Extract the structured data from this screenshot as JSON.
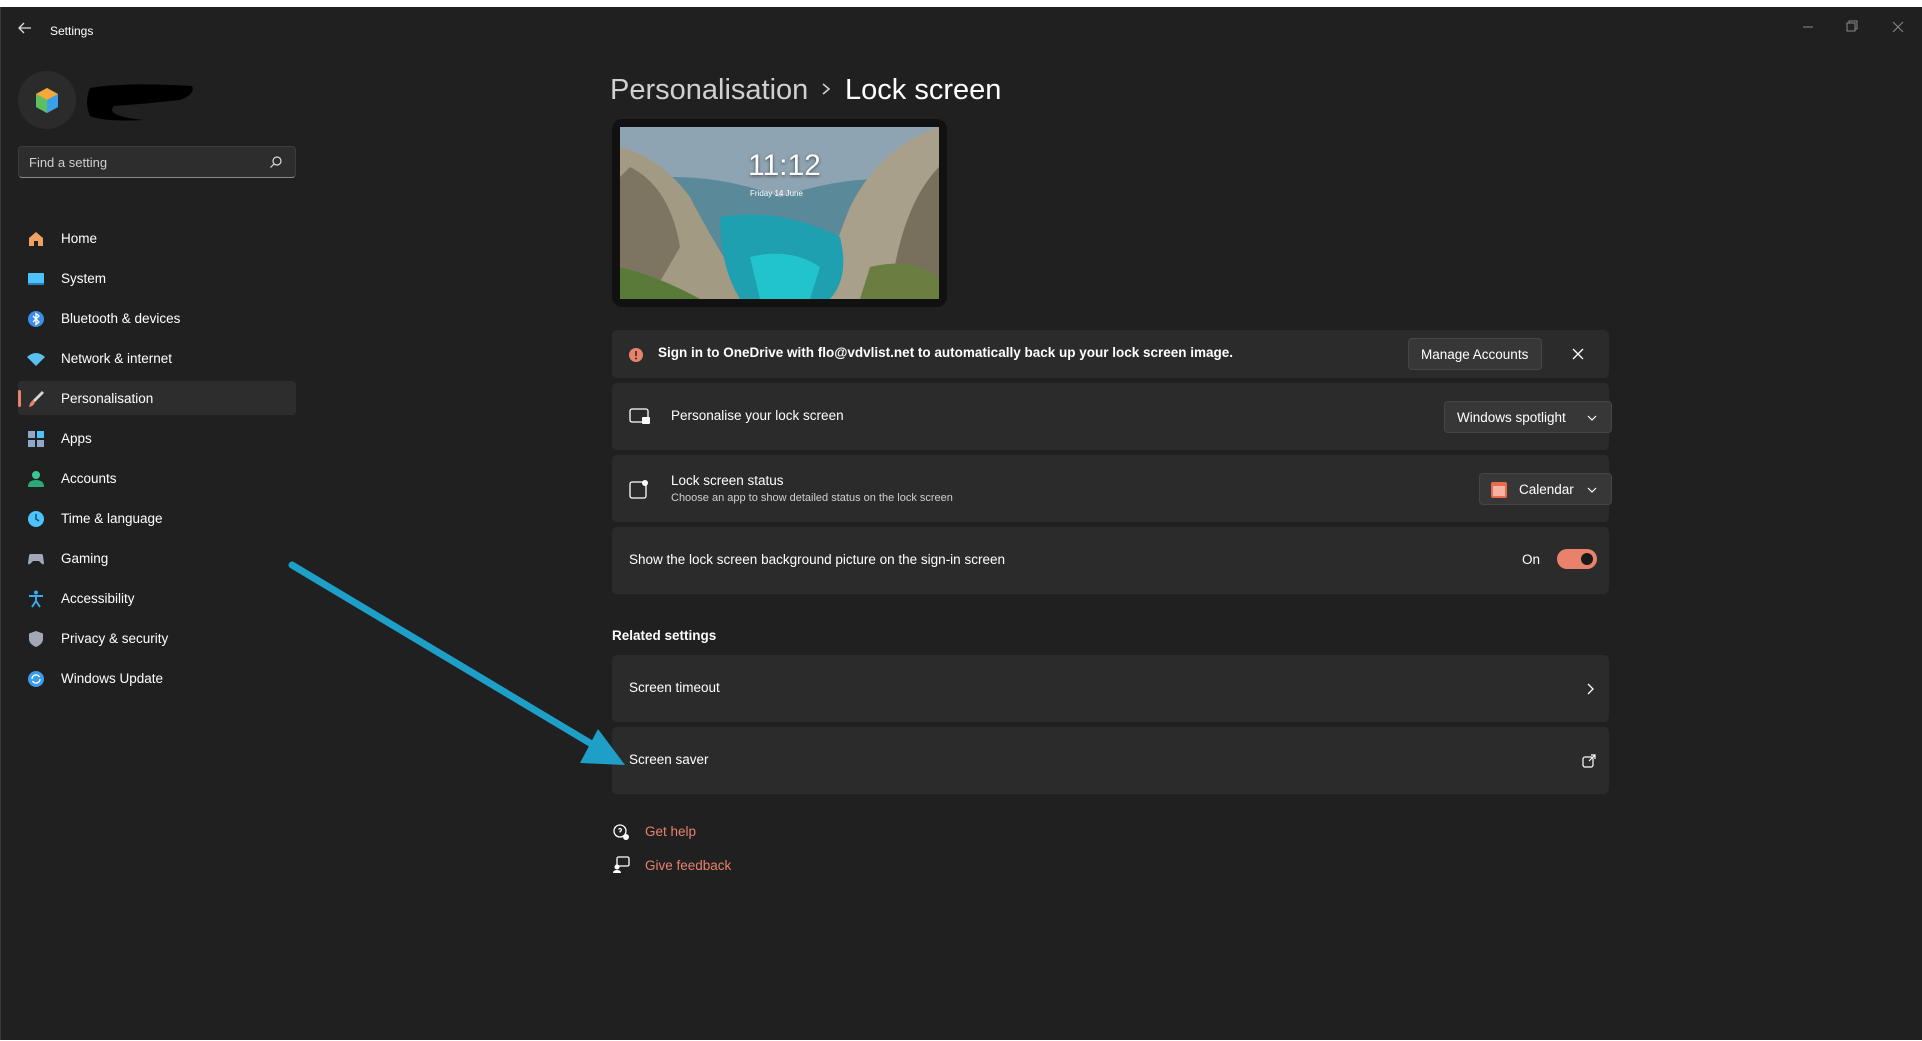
{
  "window": {
    "title": "Settings"
  },
  "sidebar": {
    "search": {
      "placeholder": "Find a setting"
    },
    "items": [
      {
        "label": "Home",
        "icon": "home-icon",
        "color": "#f0a060",
        "selected": false
      },
      {
        "label": "System",
        "icon": "system-icon",
        "color": "#4cc2ff",
        "selected": false
      },
      {
        "label": "Bluetooth & devices",
        "icon": "bluetooth-icon",
        "color": "#3b8eea",
        "selected": false
      },
      {
        "label": "Network & internet",
        "icon": "network-icon",
        "color": "#5bc0f0",
        "selected": false
      },
      {
        "label": "Personalisation",
        "icon": "brush-icon",
        "color": "#e9826b",
        "selected": true
      },
      {
        "label": "Apps",
        "icon": "apps-icon",
        "color": "#8fa8c8",
        "selected": false
      },
      {
        "label": "Accounts",
        "icon": "accounts-icon",
        "color": "#3cc690",
        "selected": false
      },
      {
        "label": "Time & language",
        "icon": "time-language-icon",
        "color": "#4cc2ff",
        "selected": false
      },
      {
        "label": "Gaming",
        "icon": "gaming-icon",
        "color": "#a0a8b8",
        "selected": false
      },
      {
        "label": "Accessibility",
        "icon": "accessibility-icon",
        "color": "#3ca8f0",
        "selected": false
      },
      {
        "label": "Privacy & security",
        "icon": "shield-icon",
        "color": "#a0a8b8",
        "selected": false
      },
      {
        "label": "Windows Update",
        "icon": "update-icon",
        "color": "#3b9cf0",
        "selected": false
      }
    ]
  },
  "breadcrumb": {
    "parent": "Personalisation",
    "current": "Lock screen"
  },
  "preview": {
    "time": "11:12",
    "date": "Friday 14 June"
  },
  "banner": {
    "message": "Sign in to OneDrive with flo@vdvlist.net to automatically back up your lock screen image.",
    "button": "Manage Accounts"
  },
  "settings": {
    "personalise": {
      "title": "Personalise your lock screen",
      "value": "Windows spotlight"
    },
    "status": {
      "title": "Lock screen status",
      "subtitle": "Choose an app to show detailed status on the lock screen",
      "value": "Calendar"
    },
    "signin_bg": {
      "title": "Show the lock screen background picture on the sign-in screen",
      "state": "On",
      "enabled": true
    }
  },
  "related": {
    "heading": "Related settings",
    "items": [
      {
        "label": "Screen timeout",
        "icon": "chevron-right-icon"
      },
      {
        "label": "Screen saver",
        "icon": "external-link-icon"
      }
    ]
  },
  "help": {
    "get_help": "Get help",
    "give_feedback": "Give feedback"
  },
  "colors": {
    "accent": "#e9826b",
    "annotation_arrow": "#1e9fc8",
    "background": "#202020",
    "card": "#2b2b2b"
  }
}
